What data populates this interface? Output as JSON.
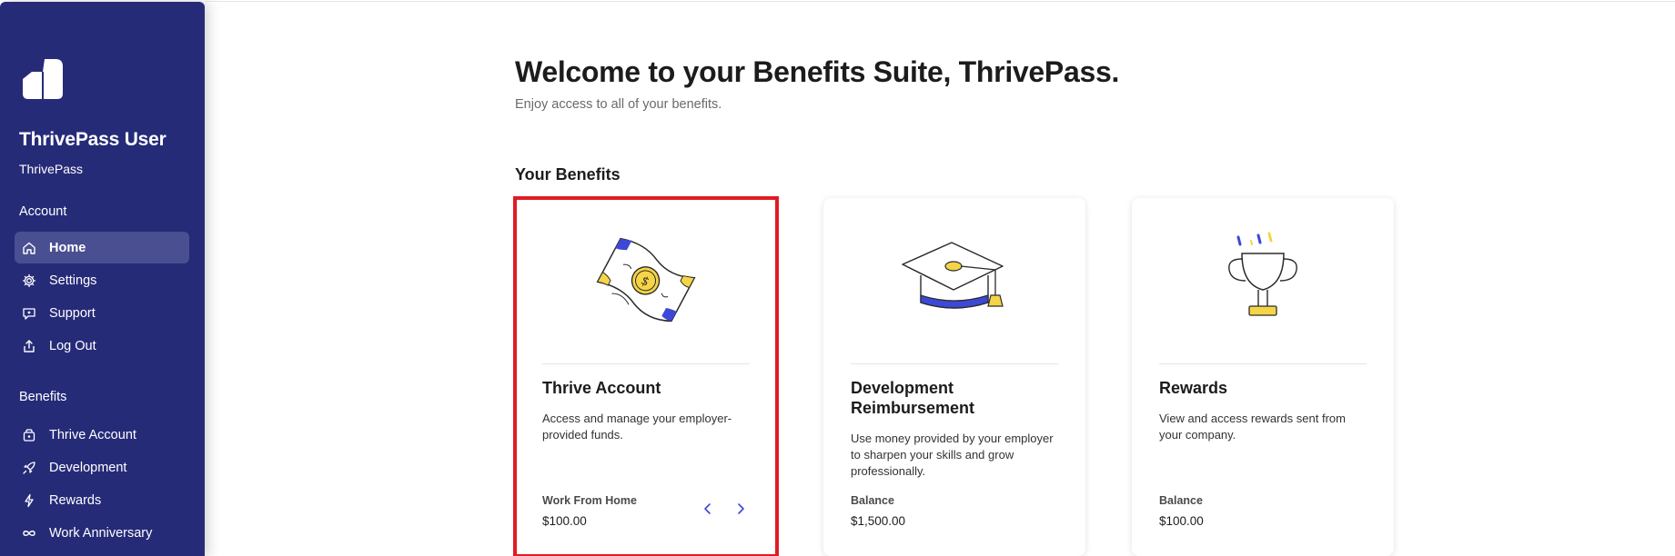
{
  "sidebar": {
    "user_name": "ThrivePass User",
    "org_name": "ThrivePass",
    "account_label": "Account",
    "benefits_label": "Benefits",
    "account_items": [
      {
        "label": "Home",
        "icon": "home-icon",
        "active": true
      },
      {
        "label": "Settings",
        "icon": "gear-icon",
        "active": false
      },
      {
        "label": "Support",
        "icon": "chat-icon",
        "active": false
      },
      {
        "label": "Log Out",
        "icon": "logout-icon",
        "active": false
      }
    ],
    "benefit_items": [
      {
        "label": "Thrive Account",
        "icon": "wallet-icon"
      },
      {
        "label": "Development",
        "icon": "rocket-icon"
      },
      {
        "label": "Rewards",
        "icon": "lightning-icon"
      },
      {
        "label": "Work Anniversary",
        "icon": "infinity-icon"
      }
    ]
  },
  "main": {
    "title": "Welcome to your Benefits Suite, ThrivePass.",
    "subtitle": "Enjoy access to all of your benefits.",
    "benefits_heading": "Your Benefits",
    "cards": [
      {
        "title": "Thrive Account",
        "description": "Access and manage your employer-provided funds.",
        "balance_label": "Work From Home",
        "balance_value": "$100.00",
        "illustration": "money-bill-illustration"
      },
      {
        "title": "Development Reimbursement",
        "description": "Use money provided by your employer to sharpen your skills and grow professionally.",
        "balance_label": "Balance",
        "balance_value": "$1,500.00",
        "illustration": "graduation-cap-illustration"
      },
      {
        "title": "Rewards",
        "description": "View and access rewards sent from your company.",
        "balance_label": "Balance",
        "balance_value": "$100.00",
        "illustration": "trophy-illustration"
      }
    ]
  },
  "colors": {
    "sidebar_bg": "#262b78",
    "sidebar_active": "#4a4f91",
    "accent_blue": "#3d48d6",
    "accent_yellow": "#f5d547",
    "selection_red": "#e01b24"
  }
}
